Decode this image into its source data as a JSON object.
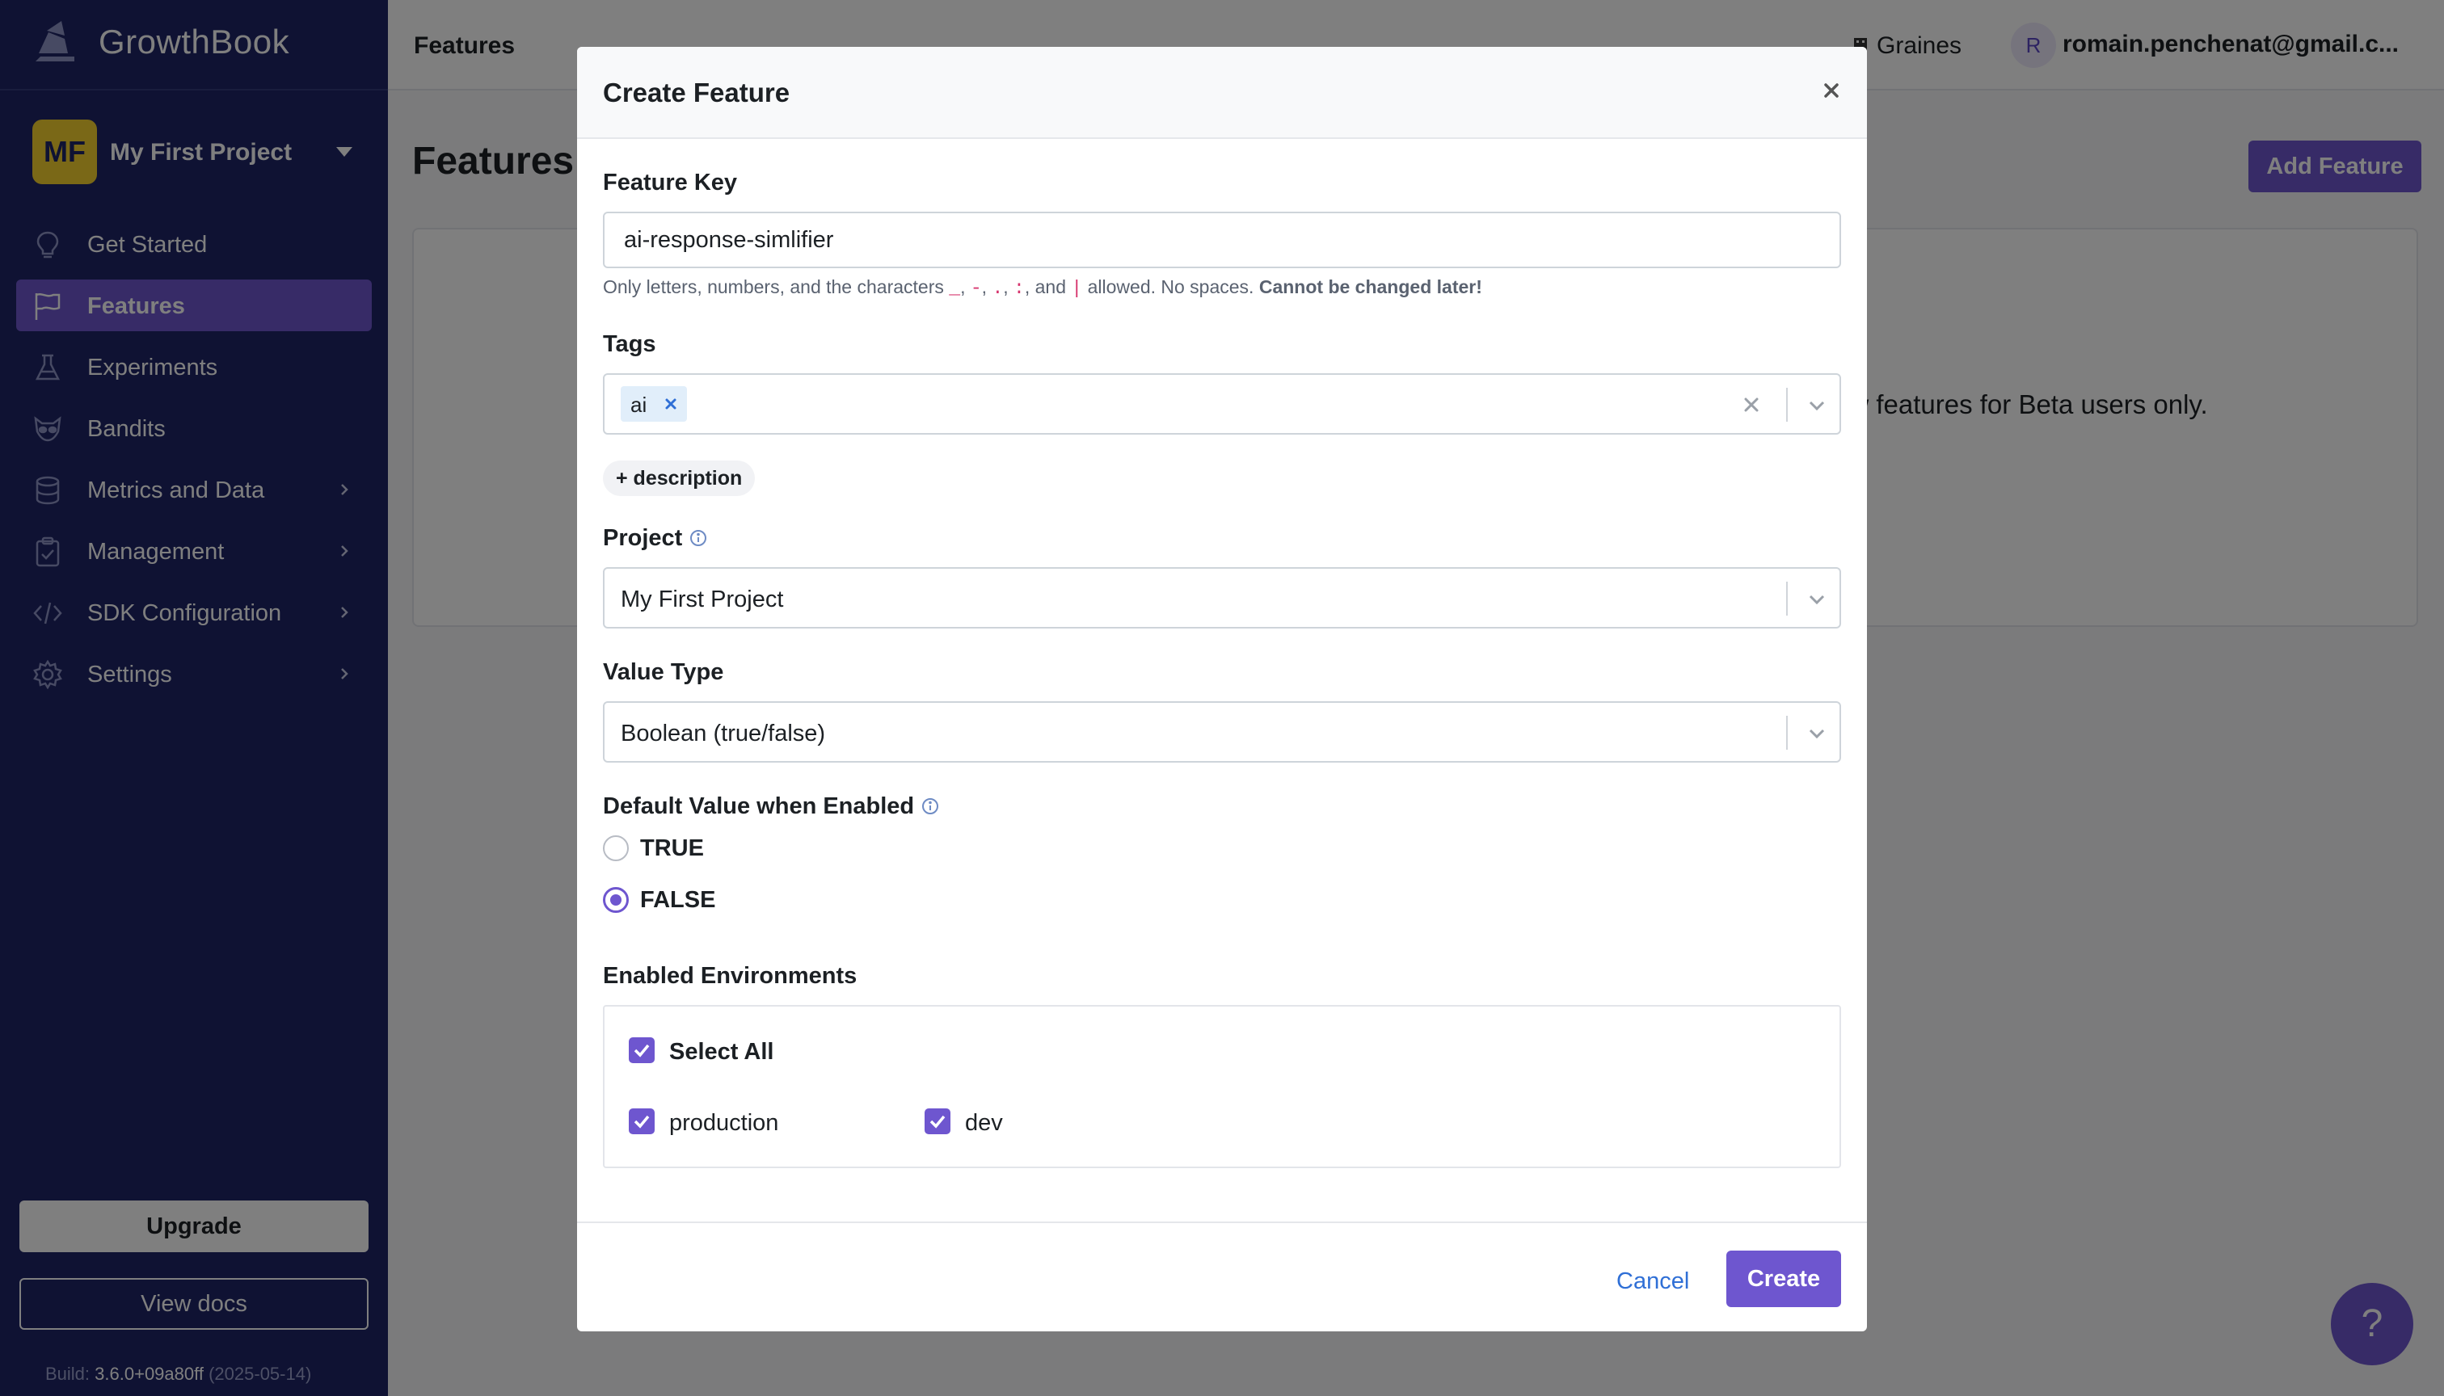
{
  "app": {
    "brand": "GrowthBook",
    "project_initials": "MF",
    "project_name": "My First Project"
  },
  "sidebar": {
    "items": [
      {
        "label": "Get Started",
        "icon": "lightbulb-icon",
        "active": false
      },
      {
        "label": "Features",
        "icon": "flag-icon",
        "active": true
      },
      {
        "label": "Experiments",
        "icon": "flask-icon",
        "active": false
      },
      {
        "label": "Bandits",
        "icon": "raccoon-icon",
        "active": false
      },
      {
        "label": "Metrics and Data",
        "icon": "database-icon",
        "active": false,
        "has_submenu": true
      },
      {
        "label": "Management",
        "icon": "clipboard-icon",
        "active": false,
        "has_submenu": true
      },
      {
        "label": "SDK Configuration",
        "icon": "code-icon",
        "active": false,
        "has_submenu": true
      },
      {
        "label": "Settings",
        "icon": "gear-icon",
        "active": false,
        "has_submenu": true
      }
    ],
    "upgrade_label": "Upgrade",
    "docs_label": "View docs",
    "build_prefix": "Build:",
    "build_version": "3.6.0+09a80ff",
    "build_date": "(2025-05-14)"
  },
  "topbar": {
    "title": "Features",
    "org_name": "Graines",
    "user_initial": "R",
    "user_email": "romain.penchenat@gmail.c..."
  },
  "main": {
    "page_title": "Features",
    "add_feature_label": "Add Feature",
    "partial_text": "ew features for Beta users only."
  },
  "help_button": "?",
  "modal": {
    "title": "Create Feature",
    "feature_key": {
      "label": "Feature Key",
      "value": "ai-response-simlifier",
      "help_prefix": "Only letters, numbers, and the characters",
      "help_chars": [
        "_",
        "-",
        ".",
        ":",
        "|"
      ],
      "help_and": "and",
      "help_suffix": "allowed. No spaces.",
      "help_warning": "Cannot be changed later!"
    },
    "tags": {
      "label": "Tags",
      "values": [
        "ai"
      ]
    },
    "description_button": "+ description",
    "project": {
      "label": "Project",
      "value": "My First Project"
    },
    "value_type": {
      "label": "Value Type",
      "value": "Boolean (true/false)"
    },
    "default_value": {
      "label": "Default Value when Enabled",
      "options": [
        "TRUE",
        "FALSE"
      ],
      "selected": "FALSE"
    },
    "environments": {
      "label": "Enabled Environments",
      "select_all_label": "Select All",
      "items": [
        {
          "name": "production",
          "checked": true
        },
        {
          "name": "dev",
          "checked": true
        }
      ]
    },
    "cancel_label": "Cancel",
    "create_label": "Create"
  },
  "colors": {
    "sidebar_bg": "#1f2567",
    "accent": "#6e56cf",
    "link": "#2f6fd6"
  }
}
